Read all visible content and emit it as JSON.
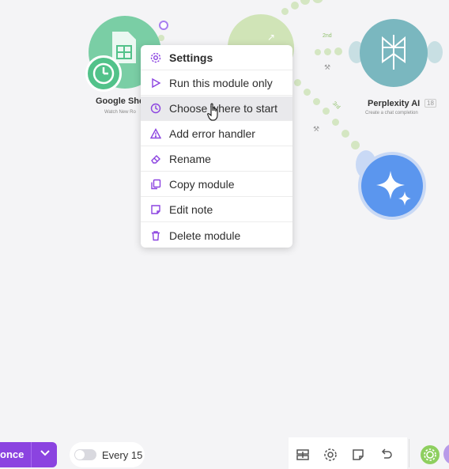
{
  "canvas": {
    "modules": [
      {
        "title": "Google She",
        "subtitle": "Watch New Ro"
      },
      {
        "title": "Perplexity AI",
        "subtitle": "Create a chat completion",
        "badge": "18"
      }
    ],
    "routes": [
      {
        "label": "2nd"
      },
      {
        "label": "3rd"
      }
    ]
  },
  "context_menu": {
    "items": [
      {
        "label": "Settings",
        "icon": "gear-icon"
      },
      {
        "label": "Run this module only",
        "icon": "play-icon"
      },
      {
        "label": "Choose where to start",
        "icon": "clock-icon"
      },
      {
        "label": "Add error handler",
        "icon": "warning-icon"
      },
      {
        "label": "Rename",
        "icon": "eraser-icon"
      },
      {
        "label": "Copy module",
        "icon": "copy-icon"
      },
      {
        "label": "Edit note",
        "icon": "note-icon"
      },
      {
        "label": "Delete module",
        "icon": "trash-icon"
      }
    ],
    "active_index": 2
  },
  "toolbar": {
    "run_label": "once",
    "schedule_label": "Every 15",
    "schedule_toggle_on": false
  },
  "colors": {
    "accent": "#8b43e0",
    "sheets_green": "#52c28a",
    "perplexity_teal": "#7ab7bf",
    "ai_blue": "#5b96ee",
    "route_green": "#d4e6c2"
  }
}
